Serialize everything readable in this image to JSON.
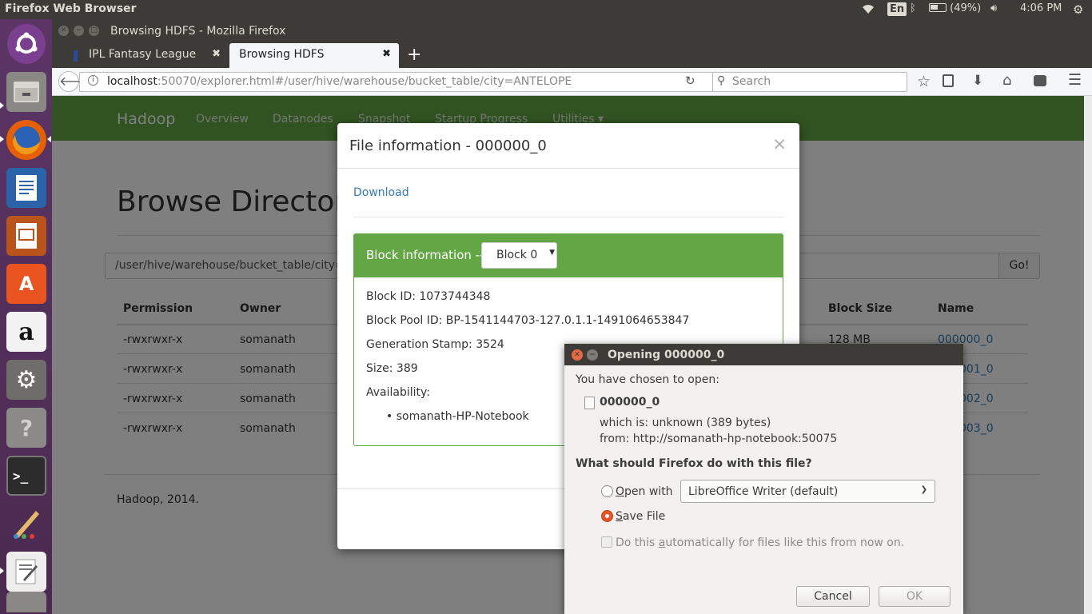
{
  "topbar": {
    "title": "Firefox Web Browser",
    "keyboard": "En",
    "battery": "(49%)",
    "time": "4:06 PM"
  },
  "launcher": {
    "items": [
      "ubuntu-icon",
      "files-icon",
      "firefox-icon",
      "writer-icon",
      "impress-icon",
      "software-center-icon",
      "amazon-icon",
      "settings-icon",
      "help-icon",
      "terminal-icon",
      "paint-icon",
      "text-editor-icon",
      "trash-icon"
    ]
  },
  "window": {
    "title": "Browsing HDFS - Mozilla Firefox",
    "tabs": [
      {
        "label": "IPL Fantasy League",
        "close": "✖"
      },
      {
        "label": "Browsing HDFS",
        "close": "✖"
      }
    ],
    "new_tab": "+"
  },
  "navbar": {
    "url_host": "localhost",
    "url_rest": ":50070/explorer.html#/user/hive/warehouse/bucket_table/city=ANTELOPE",
    "search_placeholder": "Search"
  },
  "hadoop": {
    "brand": "Hadoop",
    "nav": [
      "Overview",
      "Datanodes",
      "Snapshot",
      "Startup Progress",
      "Utilities"
    ],
    "nav_caret": "▾",
    "heading": "Browse Directory",
    "path": "/user/hive/warehouse/bucket_table/city=ANTELOPE",
    "go": "Go!",
    "columns": {
      "permission": "Permission",
      "owner": "Owner",
      "block_size": "Block Size",
      "name": "Name"
    },
    "rows": [
      {
        "permission": "-rwxrwxr-x",
        "owner": "somanath",
        "block_size": "128 MB",
        "name": "000000_0"
      },
      {
        "permission": "-rwxrwxr-x",
        "owner": "somanath",
        "block_size": "",
        "name": "000001_0"
      },
      {
        "permission": "-rwxrwxr-x",
        "owner": "somanath",
        "block_size": "",
        "name": "000002_0"
      },
      {
        "permission": "-rwxrwxr-x",
        "owner": "somanath",
        "block_size": "",
        "name": "000003_0"
      }
    ],
    "row_tails": [
      "001_0",
      "002_0",
      "003_0"
    ],
    "footer": "Hadoop, 2014."
  },
  "file_modal": {
    "title": "File information - 000000_0",
    "close": "×",
    "download": "Download",
    "block_label": "Block information --",
    "block_selected": "Block 0",
    "block_id": "Block ID: 1073744348",
    "block_pool": "Block Pool ID: BP-1541144703-127.0.1.1-1491064653847",
    "gen_stamp": "Generation Stamp: 3524",
    "size": "Size: 389",
    "availability": "Availability:",
    "hosts": [
      "somanath-HP-Notebook"
    ]
  },
  "open_dialog": {
    "title": "Opening 000000_0",
    "chosen": "You have chosen to open:",
    "filename": "000000_0",
    "which_is_label": "which is:",
    "which_is": "unknown (389 bytes)",
    "from_label": "from:",
    "from": "http://somanath-hp-notebook:50075",
    "question": "What should Firefox do with this file?",
    "open_with_key": "O",
    "open_with_rest": "pen with",
    "open_with_app": "LibreOffice Writer (default)",
    "save_key": "S",
    "save_rest": "ave File",
    "save_selected": true,
    "auto_pre": "Do this ",
    "auto_key": "a",
    "auto_post": "utomatically for files like this from now on.",
    "cancel": "Cancel",
    "ok": "OK"
  }
}
